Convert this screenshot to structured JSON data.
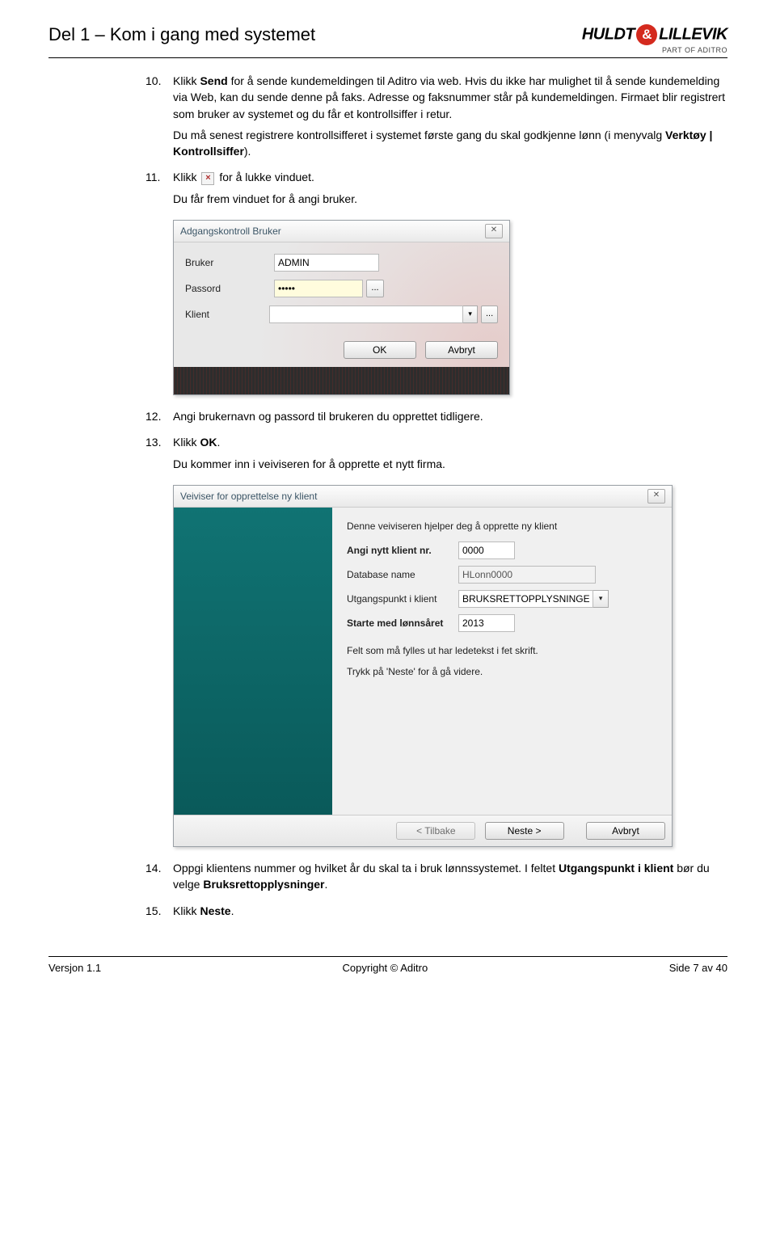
{
  "header": {
    "title": "Del 1 – Kom i gang med systemet",
    "logo_left": "HULDT",
    "logo_amp": "&",
    "logo_right": "LILLEVIK",
    "logo_sub": "PART OF ADITRO"
  },
  "steps": {
    "s10_num": "10.",
    "s10_p1a": "Klikk ",
    "s10_p1_bold": "Send",
    "s10_p1b": " for å sende kundemeldingen til Aditro via web. Hvis du ikke har mulighet til å sende kundemelding via Web, kan du sende denne på faks. Adresse og faksnummer står på kundemeldingen. Firmaet blir registrert som bruker av systemet og du får et kontrollsiffer i retur.",
    "s10_p2a": "Du må senest registrere kontrollsifferet i systemet første gang du skal godkjenne lønn (i menyvalg ",
    "s10_p2_bold": "Verktøy | Kontrollsiffer",
    "s10_p2b": ").",
    "s11_num": "11.",
    "s11_a": "Klikk ",
    "s11_b": " for å lukke vinduet.",
    "s11_p2": "Du får frem vinduet for å angi bruker.",
    "s12_num": "12.",
    "s12": "Angi brukernavn og passord til brukeren du opprettet tidligere.",
    "s13_num": "13.",
    "s13_a": "Klikk ",
    "s13_bold": "OK",
    "s13_b": ".",
    "s13_p2": "Du kommer inn i veiviseren for å opprette et nytt firma.",
    "s14_num": "14.",
    "s14_a": "Oppgi klientens nummer og hvilket år du skal ta i bruk lønnssystemet. I feltet ",
    "s14_b1": "Utgangspunkt i klient",
    "s14_c": " bør du velge ",
    "s14_b2": "Bruksrettopplysninger",
    "s14_d": ".",
    "s15_num": "15.",
    "s15_a": "Klikk ",
    "s15_bold": "Neste",
    "s15_b": "."
  },
  "dialog1": {
    "title": "Adgangskontroll Bruker",
    "labels": {
      "bruker": "Bruker",
      "passord": "Passord",
      "klient": "Klient"
    },
    "values": {
      "bruker": "ADMIN",
      "passord": "•••••",
      "klient": ""
    },
    "buttons": {
      "ok": "OK",
      "avbryt": "Avbryt"
    }
  },
  "dialog2": {
    "title": "Veiviser for opprettelse ny klient",
    "intro": "Denne veiviseren hjelper deg å opprette ny klient",
    "labels": {
      "klientnr": "Angi nytt klient nr.",
      "dbname": "Database name",
      "utgpunkt": "Utgangspunkt i klient",
      "lonnsaar": "Starte med lønnsåret"
    },
    "values": {
      "klientnr": "0000",
      "dbname": "HLonn0000",
      "utgpunkt": "BRUKSRETTOPPLYSNINGER",
      "lonnsaar": "2013"
    },
    "hint1": "Felt som må fylles ut har ledetekst i fet skrift.",
    "hint2": "Trykk på 'Neste' for å gå videre.",
    "buttons": {
      "back": "< Tilbake",
      "next": "Neste >",
      "cancel": "Avbryt"
    }
  },
  "footer": {
    "left": "Versjon 1.1",
    "center": "Copyright © Aditro",
    "right": "Side 7 av 40"
  },
  "glyphs": {
    "x": "×",
    "dots": "...",
    "tri": "▾",
    "tri2": "▼",
    "boxx": "✕"
  }
}
